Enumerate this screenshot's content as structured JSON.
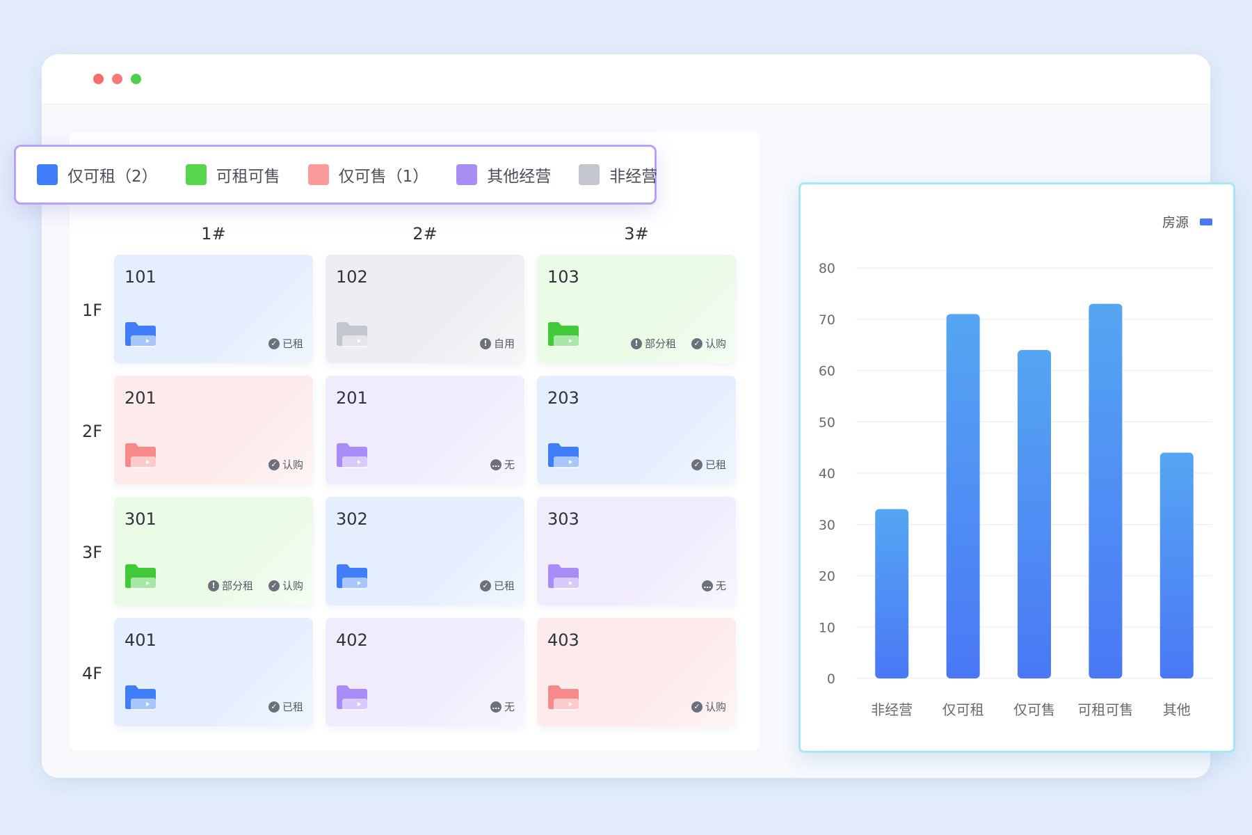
{
  "window": {
    "controls": [
      {
        "name": "close",
        "color": "#f56c6c"
      },
      {
        "name": "minimize",
        "color": "#f77a7a"
      },
      {
        "name": "maximize",
        "color": "#4fcf4f"
      }
    ]
  },
  "legend": {
    "items": [
      {
        "label": "仅可租（2）",
        "color": "#3f7ef8"
      },
      {
        "label": "可租可售",
        "color": "#57d64d"
      },
      {
        "label": "仅可售（1）",
        "color": "#f99a9a"
      },
      {
        "label": "其他经营",
        "color": "#a88df5"
      },
      {
        "label": "非经营",
        "color": "#c3c6cc"
      }
    ]
  },
  "grid": {
    "columns": [
      "1#",
      "2#",
      "3#"
    ],
    "rows": [
      {
        "floor": "1F",
        "cells": [
          {
            "number": "101",
            "status": "blue",
            "tags": [
              {
                "icon": "check",
                "label": "已租"
              }
            ]
          },
          {
            "number": "102",
            "status": "gray",
            "tags": [
              {
                "icon": "alert",
                "label": "自用"
              }
            ]
          },
          {
            "number": "103",
            "status": "green",
            "tags": [
              {
                "icon": "alert",
                "label": "部分租"
              },
              {
                "icon": "check",
                "label": "认购"
              }
            ]
          }
        ]
      },
      {
        "floor": "2F",
        "cells": [
          {
            "number": "201",
            "status": "red",
            "tags": [
              {
                "icon": "check",
                "label": "认购"
              }
            ]
          },
          {
            "number": "201",
            "status": "purple",
            "tags": [
              {
                "icon": "more",
                "label": "无"
              }
            ]
          },
          {
            "number": "203",
            "status": "blue",
            "tags": [
              {
                "icon": "check",
                "label": "已租"
              }
            ]
          }
        ]
      },
      {
        "floor": "3F",
        "cells": [
          {
            "number": "301",
            "status": "green",
            "tags": [
              {
                "icon": "alert",
                "label": "部分租"
              },
              {
                "icon": "check",
                "label": "认购"
              }
            ]
          },
          {
            "number": "302",
            "status": "blue",
            "tags": [
              {
                "icon": "check",
                "label": "已租"
              }
            ]
          },
          {
            "number": "303",
            "status": "purple",
            "tags": [
              {
                "icon": "more",
                "label": "无"
              }
            ]
          }
        ]
      },
      {
        "floor": "4F",
        "cells": [
          {
            "number": "401",
            "status": "blue",
            "tags": [
              {
                "icon": "check",
                "label": "已租"
              }
            ]
          },
          {
            "number": "402",
            "status": "purple",
            "tags": [
              {
                "icon": "more",
                "label": "无"
              }
            ]
          },
          {
            "number": "403",
            "status": "red",
            "tags": [
              {
                "icon": "check",
                "label": "认购"
              }
            ]
          }
        ]
      }
    ]
  },
  "status_colors": {
    "blue": {
      "bg": "#e4eefd",
      "folder": "#3f7ef8"
    },
    "gray": {
      "bg": "#eceef1",
      "folder": "#c3c6cc"
    },
    "green": {
      "bg": "#eafbe6",
      "folder": "#41c93a"
    },
    "red": {
      "bg": "#fdeaea",
      "folder": "#f58a8a"
    },
    "purple": {
      "bg": "#f1ecfd",
      "folder": "#a88df5"
    }
  },
  "chart_data": {
    "type": "bar",
    "categories": [
      "非经营",
      "仅可租",
      "仅可售",
      "可租可售",
      "其他"
    ],
    "series": [
      {
        "name": "房源",
        "values": [
          33,
          71,
          64,
          73,
          44
        ],
        "color": "#4a78f5"
      }
    ],
    "ylim": [
      0,
      80
    ],
    "yticks": [
      0,
      10,
      20,
      30,
      40,
      50,
      60,
      70,
      80
    ],
    "grid": true,
    "legend_position": "top-right"
  }
}
